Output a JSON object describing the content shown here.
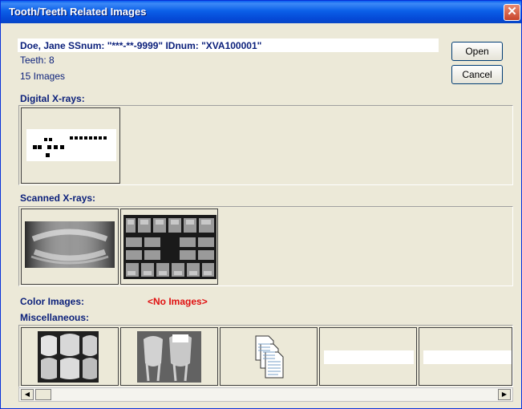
{
  "window": {
    "title": "Tooth/Teeth Related Images",
    "close_glyph": "✕"
  },
  "patient": {
    "line": "Doe, Jane  SSnum: \"***-**-9999\"  IDnum: \"XVA100001\"",
    "teeth": "Teeth: 8",
    "images": "15 Images"
  },
  "buttons": {
    "open": "Open",
    "cancel": "Cancel"
  },
  "sections": {
    "digital": "Digital X-rays:",
    "scanned": "Scanned X-rays:",
    "color": "Color Images:",
    "color_empty": "<No Images>",
    "misc": "Miscellaneous:"
  },
  "icons": {
    "close": "close-icon",
    "scroll_left": "scroll-left-arrow-icon",
    "scroll_right": "scroll-right-arrow-icon",
    "documents": "documents-icon"
  },
  "scrollbar": {
    "left_glyph": "◀",
    "right_glyph": "▶"
  },
  "colors": {
    "title_bar": "#0b5fe8",
    "label_text": "#0a1f7a",
    "no_images_text": "#e01010"
  }
}
